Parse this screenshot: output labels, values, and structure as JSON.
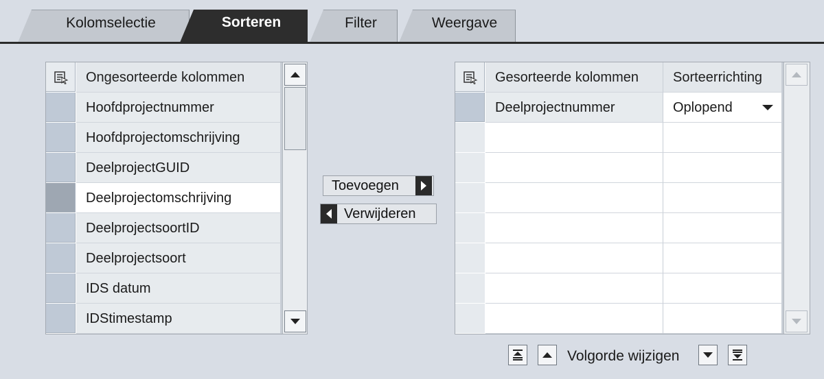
{
  "tabs": [
    {
      "label": "Kolomselectie",
      "active": false
    },
    {
      "label": "Sorteren",
      "active": true
    },
    {
      "label": "Filter",
      "active": false
    },
    {
      "label": "Weergave",
      "active": false
    }
  ],
  "unsorted": {
    "header": "Ongesorteerde kolommen",
    "rows": [
      "Hoofdprojectnummer",
      "Hoofdprojectomschrijving",
      "DeelprojectGUID",
      "Deelprojectomschrijving",
      "DeelprojectsoortID",
      "Deelprojectsoort",
      "IDS datum",
      "IDStimestamp"
    ],
    "selected_index": 3
  },
  "sorted": {
    "header_column": "Gesorteerde kolommen",
    "header_direction": "Sorteerrichting",
    "rows": [
      {
        "column": "Deelprojectnummer",
        "direction": "Oplopend"
      }
    ]
  },
  "buttons": {
    "add": "Toevoegen",
    "remove": "Verwijderen"
  },
  "order": {
    "label": "Volgorde wijzigen"
  },
  "icons": {
    "column_settings": "column-settings-icon",
    "scroll_up": "scroll-up-icon",
    "scroll_down": "scroll-down-icon",
    "move_top": "move-to-top-icon",
    "move_up": "move-up-icon",
    "move_down": "move-down-icon",
    "move_bottom": "move-to-bottom-icon",
    "dropdown": "dropdown-arrow-icon"
  },
  "colors": {
    "active_tab": "#2d2d2d",
    "inactive_tab": "#c3c8cf",
    "background": "#d8dde5"
  }
}
